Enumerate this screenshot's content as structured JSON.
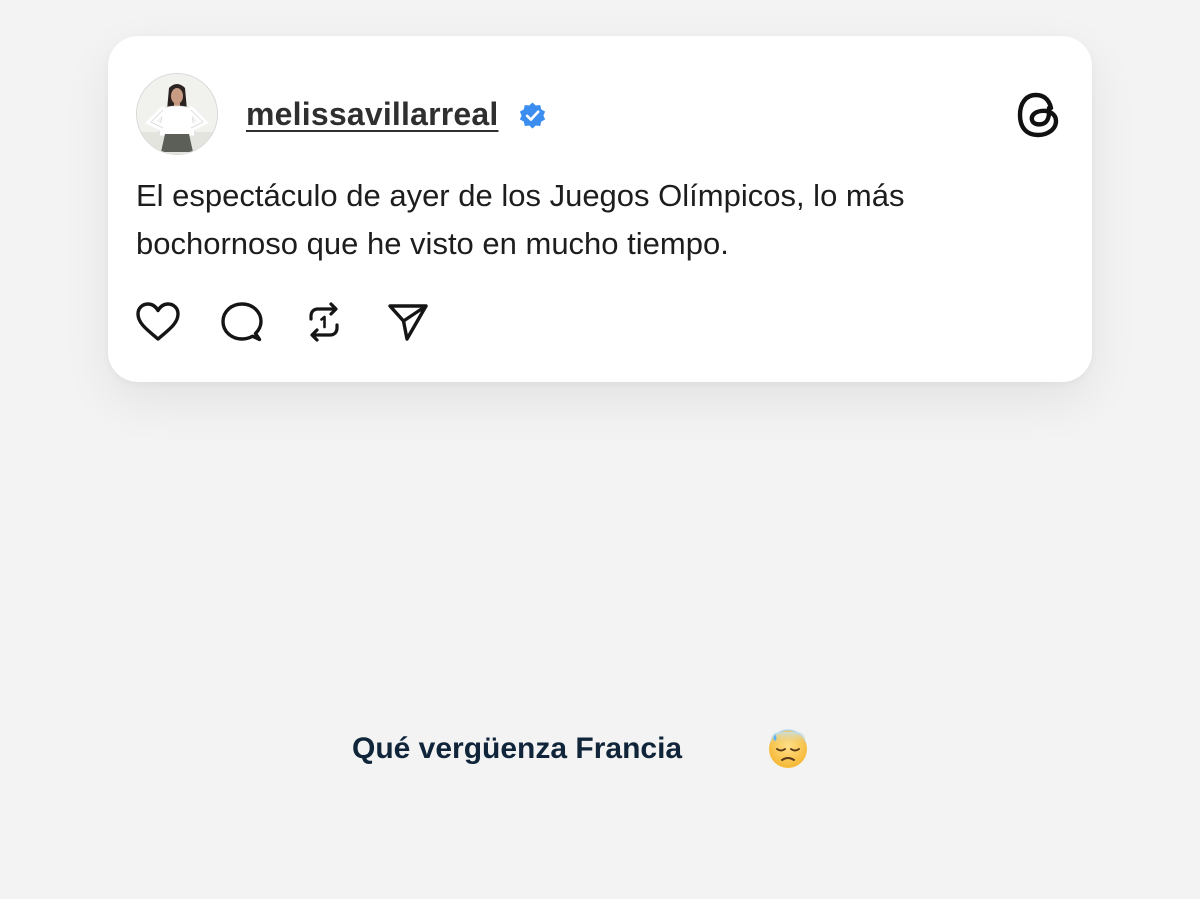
{
  "post": {
    "username": "melissavillarreal",
    "verified_icon": "verified-badge-icon",
    "app_icon": "threads-logo-icon",
    "text_lines": [
      "El espectáculo de ayer de los Juegos Olímpicos, lo más",
      "bochornoso que he visto en mucho tiempo."
    ],
    "actions": [
      "heart-icon",
      "comment-icon",
      "repost-icon",
      "share-icon"
    ]
  },
  "caption": {
    "text": "Qué vergüenza Francia",
    "emoji": "downcast-face-with-sweat-emoji"
  },
  "colors": {
    "background": "#f3f3f3",
    "card": "#ffffff",
    "verified_blue": "#3b8ef0",
    "caption_text": "#10253a"
  }
}
